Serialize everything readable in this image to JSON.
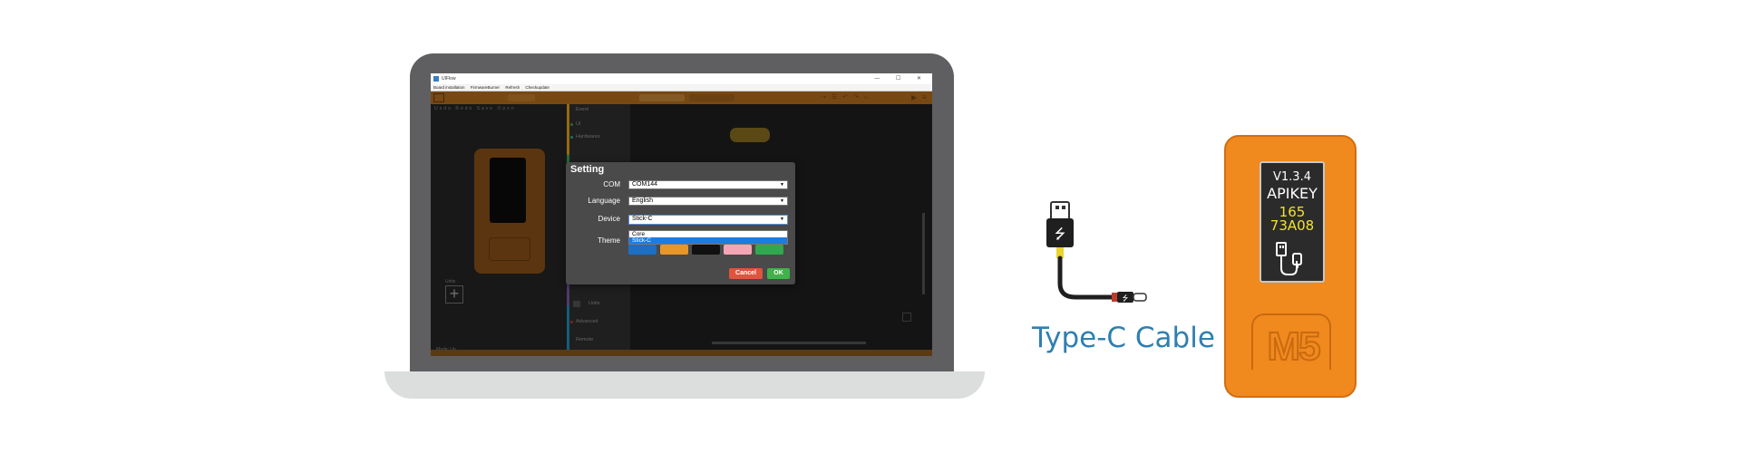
{
  "window": {
    "title": "UIFlow",
    "controls": "— ☐ ✕",
    "menu": [
      "Board installation",
      "FirmwareBurner",
      "Refresh",
      "Checkupdate"
    ]
  },
  "left_panel": {
    "tabs": [
      "Undo",
      "Redo",
      "Save",
      "Open"
    ],
    "units_label": "Units",
    "mode_label": "Mode: Up"
  },
  "blocks_panel": {
    "categories": [
      {
        "label": "Event",
        "color": "#e8a317"
      },
      {
        "label": "UI",
        "color": "#3aa655"
      },
      {
        "label": "Hardwares",
        "color": "#27a9a3"
      },
      {
        "label": "Units",
        "color": "#7a5aa8"
      },
      {
        "label": "Advanced",
        "color": "#c2392f"
      },
      {
        "label": "Remote",
        "color": "#1f8fbf"
      }
    ]
  },
  "dialog": {
    "title": "Setting",
    "com_label": "COM",
    "com_value": "COM144",
    "language_label": "Language",
    "language_value": "English",
    "device_label": "Device",
    "device_value": "Stick-C",
    "device_options": [
      "Core",
      "Stick-C"
    ],
    "device_selected_option": "Stick-C",
    "theme_label": "Theme",
    "theme_colors": [
      "#1d6fc4",
      "#e8962a",
      "#111111",
      "#f4a6b5",
      "#2fa84f"
    ],
    "cancel_label": "Cancel",
    "ok_label": "OK",
    "cancel_color": "#e0533d",
    "ok_color": "#3fb24a"
  },
  "cable": {
    "label": "Type-C Cable",
    "label_color": "#2f7fb0"
  },
  "device": {
    "version": "V1.3.4",
    "apikey_label": "APIKEY",
    "apikey_line1": "165",
    "apikey_line2": "73A08",
    "logo_text": "M5",
    "body_color": "#f0891e",
    "apikey_color": "#f2e230"
  }
}
